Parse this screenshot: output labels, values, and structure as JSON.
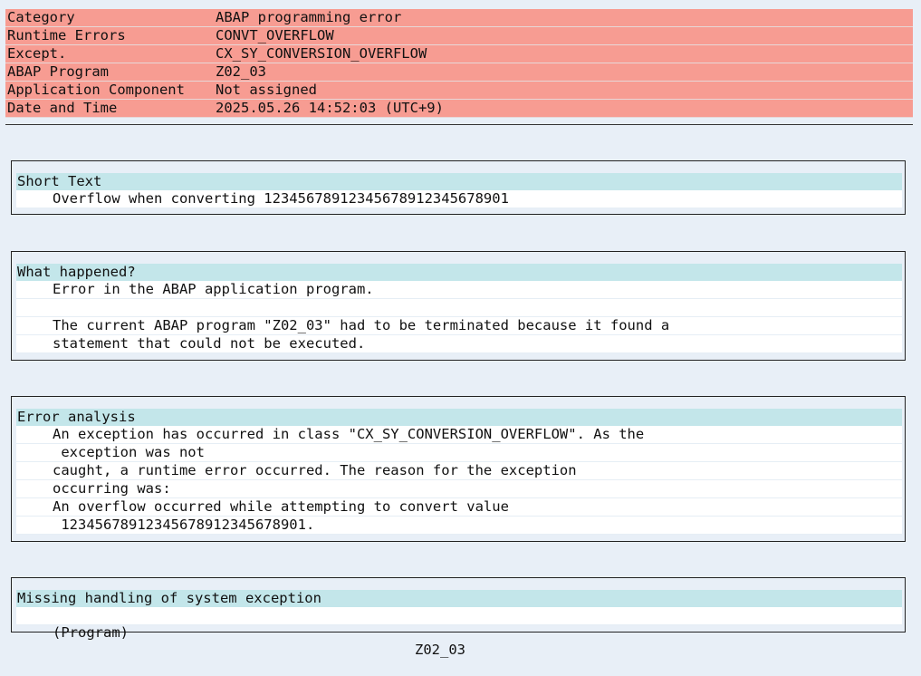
{
  "header": {
    "rows": [
      {
        "key": "Category",
        "value": "ABAP programming error"
      },
      {
        "key": "Runtime Errors",
        "value": "CONVT_OVERFLOW"
      },
      {
        "key": "Except.",
        "value": "CX_SY_CONVERSION_OVERFLOW"
      },
      {
        "key": "ABAP Program",
        "value": "Z02_03"
      },
      {
        "key": "Application Component",
        "value": "Not assigned"
      },
      {
        "key": "Date and Time",
        "value": "2025.05.26 14:52:03 (UTC+9)"
      }
    ]
  },
  "short_text": {
    "title": "Short Text",
    "lines": [
      "Overflow when converting 1234567891234567891234567890‌1"
    ]
  },
  "what_happened": {
    "title": "What happened?",
    "lines": [
      "Error in the ABAP application program.",
      "",
      "The current ABAP program \"Z02_03\" had to be terminated because it found a",
      "statement that could not be executed."
    ]
  },
  "error_analysis": {
    "title": "Error analysis",
    "lines": [
      "An exception has occurred in class \"CX_SY_CONVERSION_OVERFLOW\". As the",
      " exception was not",
      "caught, a runtime error occurred. The reason for the exception",
      "occurring was:",
      "An overflow occurred while attempting to convert value",
      " 1234567891234567891234567890‌1."
    ]
  },
  "missing_handling": {
    "title": "Missing handling of system exception",
    "label": "(Program)",
    "value": "Z02_03"
  }
}
